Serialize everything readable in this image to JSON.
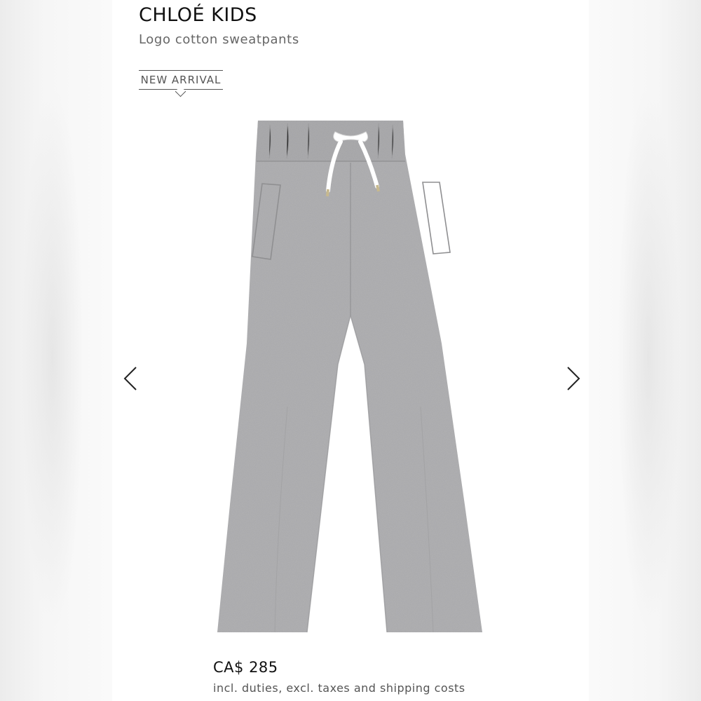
{
  "product": {
    "brand": "CHLOÉ KIDS",
    "name": "Logo cotton sweatpants",
    "badge": "NEW ARRIVAL",
    "price": "CA$ 285",
    "price_note": "incl. duties, excl. taxes and shipping costs"
  },
  "gallery": {
    "image_icon": "grey-sweatpants-image",
    "prev_icon": "chevron-left-icon",
    "next_icon": "chevron-right-icon"
  },
  "colors": {
    "fabric": "#a9a9ab",
    "drawstring": "#ffffff",
    "text": "#111111",
    "muted": "#666666"
  }
}
